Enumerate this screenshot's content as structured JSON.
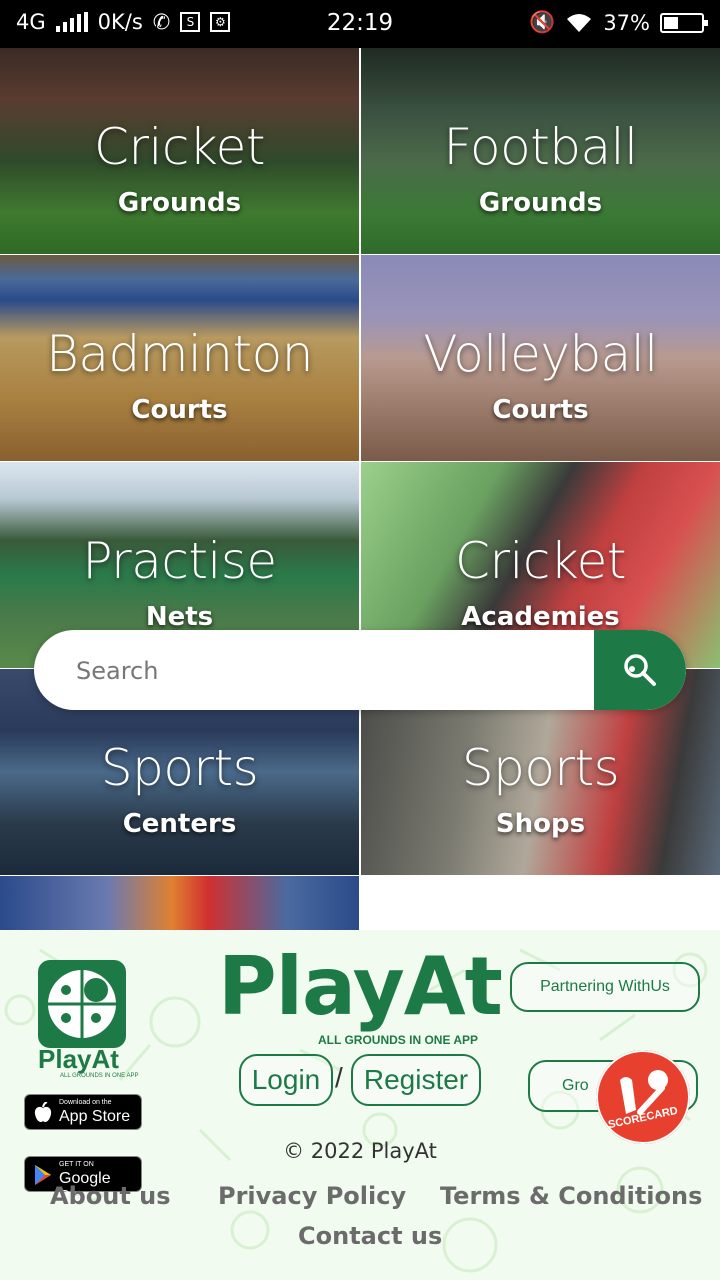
{
  "status": {
    "network": "4G",
    "speed": "0K/s",
    "time": "22:19",
    "battery": "37%",
    "icons": [
      "signal-icon",
      "whatsapp-icon",
      "s-icon",
      "settings-icon",
      "mute-icon",
      "wifi-icon",
      "battery-icon"
    ]
  },
  "tiles": [
    {
      "title": "Cricket",
      "sub": "Grounds"
    },
    {
      "title": "Football",
      "sub": "Grounds"
    },
    {
      "title": "Badminton",
      "sub": "Courts"
    },
    {
      "title": "Volleyball",
      "sub": "Courts"
    },
    {
      "title": "Practise",
      "sub": "Nets"
    },
    {
      "title": "Cricket",
      "sub": "Academies"
    },
    {
      "title": "Sports",
      "sub": "Centers"
    },
    {
      "title": "Sports",
      "sub": "Shops"
    }
  ],
  "search": {
    "placeholder": "Search"
  },
  "footer": {
    "logo_small": "Play\nAt",
    "logo_name": "PlayAt",
    "logo_tag": "ALL GROUNDS IN ONE APP",
    "appstore_small": "Download on the",
    "appstore_big": "App Store",
    "play_small": "GET IT ON",
    "play_big": "Google Play",
    "brand": "PlayAt",
    "brand_tag": "ALL GROUNDS IN ONE APP",
    "partner": "Partnering WithUs",
    "login": "Login",
    "sep": "/",
    "register": "Register",
    "ground_partial": "Gro",
    "score_text": "SCORECARD",
    "copyright": "© 2022 PlayAt",
    "about": "About us",
    "privacy": "Privacy Policy",
    "terms": "Terms & Conditions",
    "contact": "Contact us"
  }
}
